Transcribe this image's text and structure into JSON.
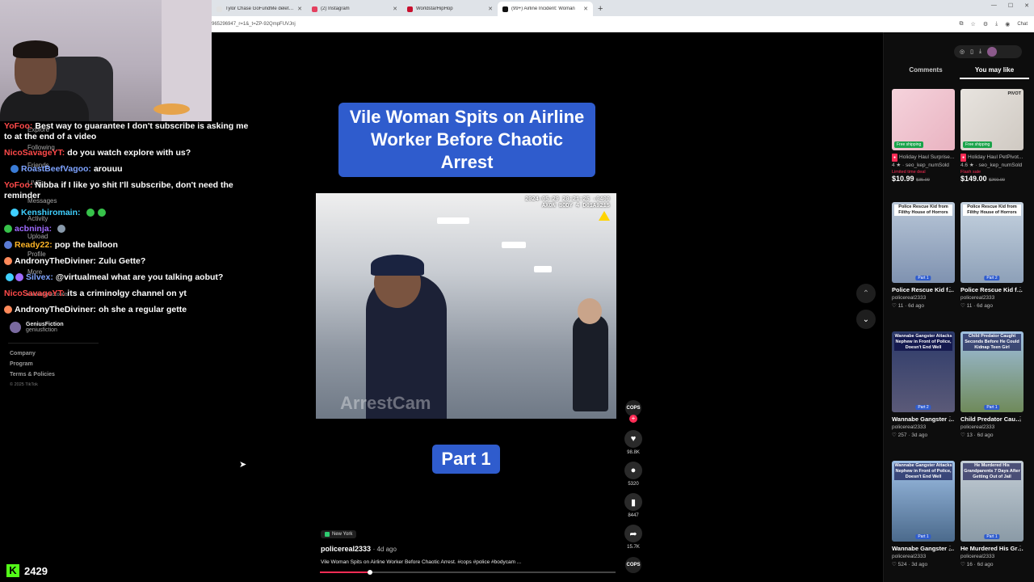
{
  "browser": {
    "tabs": [
      {
        "title": "Tylor Chase GoFundMe deleted a",
        "favicon_color": "#e1e1e1"
      },
      {
        "title": "(2) Instagram",
        "favicon_color": "#e4405f"
      },
      {
        "title": "WorldstarHipHop",
        "favicon_color": "#c8102e"
      },
      {
        "title": "(99+) Airline Incident: Woman",
        "favicon_color": "#111111"
      }
    ],
    "new_tab": "+",
    "url": "965296947_r=1&_t=ZP-92QmpFUVJnj",
    "chat_label": "Chat"
  },
  "left_nav": {
    "items": [
      "Explore",
      "Following",
      "Friends",
      "LIVE",
      "Messages",
      "Activity",
      "Upload",
      "Profile",
      "More",
      "Following accounts"
    ],
    "following": {
      "name": "GeniusFiction",
      "handle": "geniusfiction"
    },
    "footer": {
      "company": "Company",
      "program": "Program",
      "terms": "Terms & Policies",
      "copyright": "© 2025 TikTok"
    }
  },
  "chat": {
    "messages": [
      {
        "user": "YoFoo:",
        "color": "#ff4a4a",
        "text": "Best way to guarantee I don't subscribe is asking me"
      },
      {
        "user": "",
        "color": "#ffffff",
        "text": "to at the end of a video"
      },
      {
        "user": "NicoSavageYT:",
        "color": "#ff4a4a",
        "text": "do you watch explore with us?"
      },
      {
        "user": "RoastBeefVagoo:",
        "color": "#7ea3ff",
        "text": "arouuu"
      },
      {
        "user": "YoFoo:",
        "color": "#ff4a4a",
        "text": "Nibba if I like yo shit I'll subscribe, don't need the"
      },
      {
        "user": "",
        "color": "#ffffff",
        "text": "reminder"
      },
      {
        "user": "Kenshiromain:",
        "color": "#3fd0ff",
        "text": ""
      },
      {
        "user": "acbninja:",
        "color": "#9f6bff",
        "text": ""
      },
      {
        "user": "Ready22:",
        "color": "#ffb627",
        "text": "pop the balloon"
      },
      {
        "user": "AndronyTheDiviner:",
        "color": "#ffffff",
        "text": "Zulu Gette?"
      },
      {
        "user": "Silvex:",
        "color": "#7ea3ff",
        "text": "@virtualmeal what are you talking aobut?"
      },
      {
        "user": "NicoSavageYT:",
        "color": "#ff4a4a",
        "text": "its a criminolgy channel on yt"
      },
      {
        "user": "AndronyTheDiviner:",
        "color": "#ffffff",
        "text": "oh she a regular gette"
      }
    ]
  },
  "kick": {
    "logo": "K",
    "viewers": "2429"
  },
  "video": {
    "title": "Vile Woman Spits on Airline Worker Before Chaotic Arrest",
    "timestamp": "2024-05-29 20:21:25 -0400",
    "camera": "AXON BODY 4 D01A9215",
    "watermark": "ArrestCam",
    "part": "Part 1",
    "location": "New York",
    "author": "policereal2333",
    "age": "· 4d ago",
    "caption": "Vile Woman Spits on Airline Worker Before Chaotic Arrest.   #cops #police #bodycam ...",
    "progress": 0.17
  },
  "actions": {
    "avatar_label": "COPS",
    "likes": "98.8K",
    "comments": "5320",
    "saves": "8447",
    "shares": "15.7K"
  },
  "right_panel": {
    "tabs": [
      "Comments",
      "You may like"
    ],
    "cards": [
      {
        "title": "Holiday Haul  Surprise...",
        "rating": "4 ★ · seo_kep_numSold",
        "deal": "Limited time deal",
        "price": "$10.99",
        "old_price": "$35.00",
        "badge": "Free shipping",
        "thumb_text": "",
        "color": "#e9b3c1"
      },
      {
        "title": "Holiday Haul  PetPivot...",
        "rating": "4.6 ★ · seo_kep_numSold",
        "deal": "Flash sale",
        "price": "$149.00",
        "old_price": "$260.00",
        "badge": "Free shipping",
        "thumb_text": "PIVOT",
        "color": "#cfc9c2"
      },
      {
        "title": "Police Rescue Kid from Filthy Hous...",
        "author": "policereal2333",
        "stats": "♡ 11 · 6d ago",
        "thumb_text": "Police Rescue Kid from Filthy House of Horrors",
        "chip": "Part 1",
        "color": "#7f92b0"
      },
      {
        "title": "Police Rescue Kid from Filthy Hous...",
        "author": "policereal2333",
        "stats": "♡ 11 · 6d ago",
        "thumb_text": "Police Rescue Kid from Filthy House of Horrors",
        "chip": "Part 2",
        "color": "#8da0b8"
      },
      {
        "title": "Wannabe Gangster Attacks...",
        "author": "policereal2333",
        "stats": "♡ 257 · 3d ago",
        "thumb_text": "Wannabe Gangster Attacks Nephew in Front of Police, Doesn't End Well",
        "chip": "Part 2",
        "color": "#5b5a78"
      },
      {
        "title": "Child Predator Caught Seconds...",
        "author": "policereal2333",
        "stats": "♡ 13 · 6d ago",
        "thumb_text": "Child Predator Caught Seconds Before He Could Kidnap Teen Girl",
        "chip": "Part 1",
        "color": "#6f8a5a"
      },
      {
        "title": "Wannabe Gangster Attacks...",
        "author": "policereal2333",
        "stats": "♡ 524 · 3d ago",
        "thumb_text": "Wannabe Gangster Attacks Nephew in Front of Police, Doesn't End Well",
        "chip": "Part 1",
        "color": "#4b6a8c"
      },
      {
        "title": "He Murdered His Grandparents 7...",
        "author": "policereal2333",
        "stats": "♡ 16 · 6d ago",
        "thumb_text": "He Murdered His Grandparents 7 Days After Getting Out of Jail",
        "chip": "Part 1",
        "color": "#8a9aa6"
      }
    ]
  }
}
